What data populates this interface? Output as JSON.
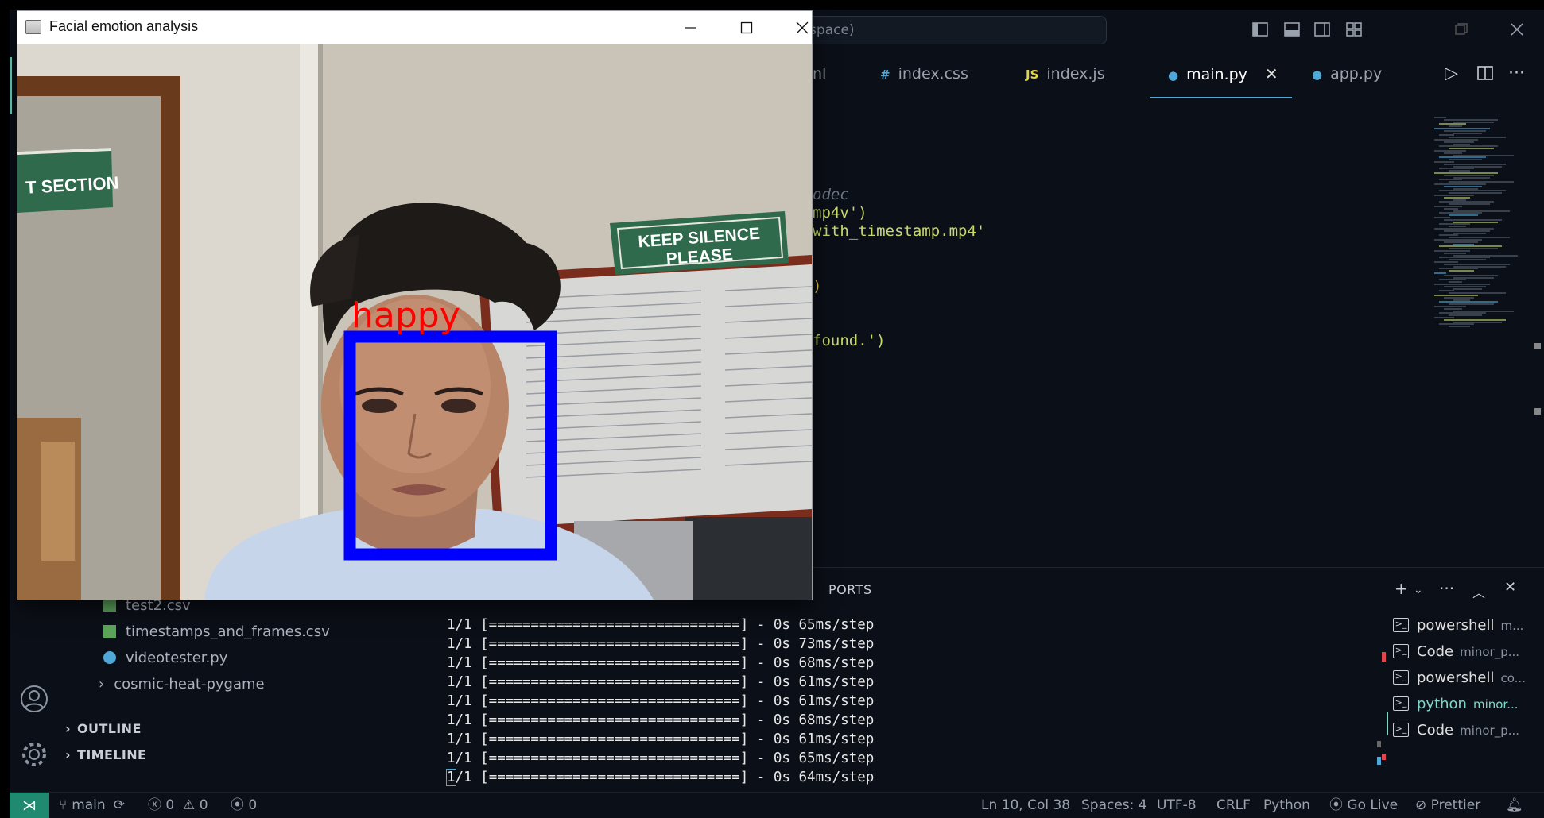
{
  "emotion_window": {
    "title": "Facial emotion analysis",
    "detected_emotion": "happy",
    "sign_section": "T SECTION",
    "sign_silence_line1": "KEEP SILENCE",
    "sign_silence_line2": "PLEASE",
    "box_color": "#0000ff",
    "label_color": "#ff0000"
  },
  "titlebar": {
    "search_text": "Workspace)"
  },
  "tabs": [
    {
      "icon": "",
      "label": "nl"
    },
    {
      "icon": "#",
      "label": "index.css"
    },
    {
      "icon": "JS",
      "label": "index.js"
    },
    {
      "icon": "",
      "label": "main.py",
      "active": true
    },
    {
      "icon": "",
      "label": "app.py"
    }
  ],
  "editor": {
    "lines": [
      "odec",
      "mp4v')",
      "with_timestamp.mp4'",
      ")",
      "found.')"
    ]
  },
  "panel": {
    "ports_label": "PORTS",
    "terminal_lines": [
      "1/1 [==============================] - 0s 65ms/step",
      "1/1 [==============================] - 0s 73ms/step",
      "1/1 [==============================] - 0s 68ms/step",
      "1/1 [==============================] - 0s 61ms/step",
      "1/1 [==============================] - 0s 61ms/step",
      "1/1 [==============================] - 0s 68ms/step",
      "1/1 [==============================] - 0s 61ms/step",
      "1/1 [==============================] - 0s 65ms/step",
      "1/1 [==============================] - 0s 64ms/step"
    ],
    "terminals": [
      {
        "name": "powershell",
        "sub": "m..."
      },
      {
        "name": "Code",
        "sub": "minor_p..."
      },
      {
        "name": "powershell",
        "sub": "co..."
      },
      {
        "name": "python",
        "sub": "minor...",
        "active": true
      },
      {
        "name": "Code",
        "sub": "minor_p..."
      }
    ]
  },
  "sidebar": {
    "files": [
      "test2.csv",
      "timestamps_and_frames.csv",
      "videotester.py",
      "cosmic-heat-pygame"
    ],
    "outline": "OUTLINE",
    "timeline": "TIMELINE"
  },
  "statusbar": {
    "branch": "main",
    "errors": "0",
    "warnings": "0",
    "ports": "0",
    "position": "Ln 10, Col 38",
    "spaces": "Spaces: 4",
    "encoding": "UTF-8",
    "eol": "CRLF",
    "language": "Python",
    "go_live": "Go Live",
    "prettier": "Prettier"
  },
  "colors": {
    "accent": "#4fa8d8",
    "remote": "#1f8a70",
    "string": "#c8d96a",
    "comment": "#6b7686"
  }
}
